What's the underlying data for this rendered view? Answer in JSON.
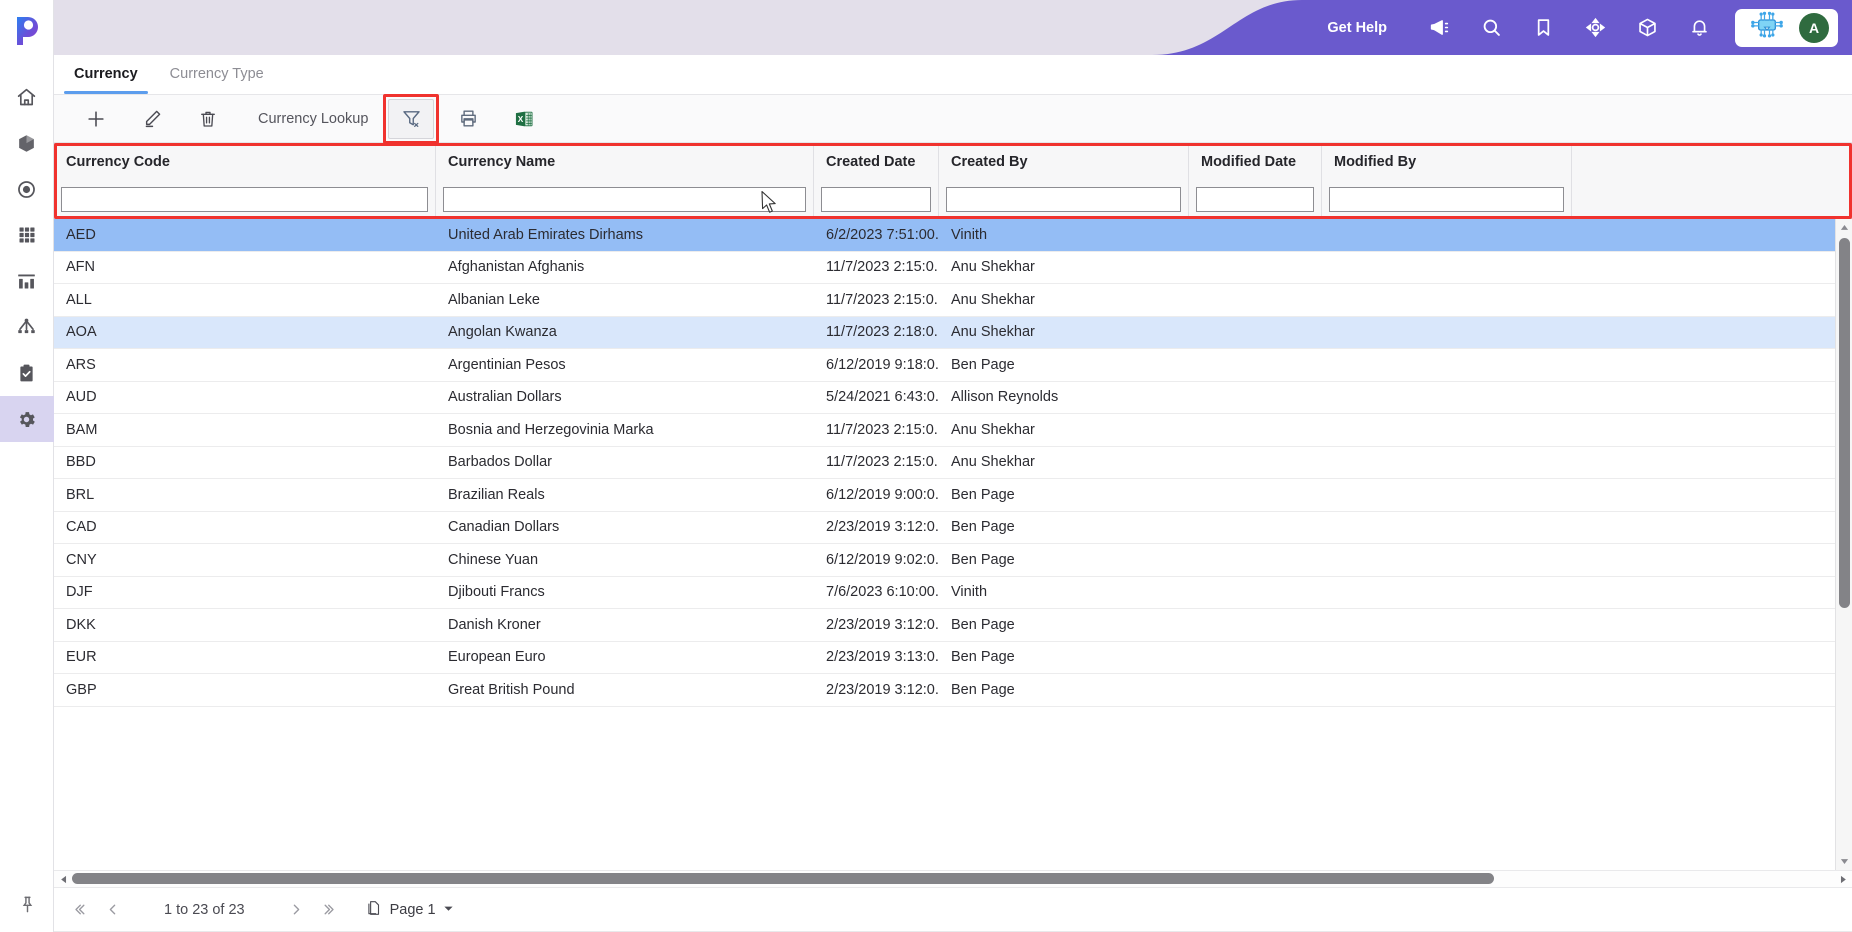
{
  "app": {
    "logo_icon": "priority-p-logo",
    "accent_purple": "#6a5acd",
    "header_bg": "#e3dfea",
    "tab_underline": "#5c9ded",
    "selected_row_color": "#94bdf5",
    "hover_row_color": "#d9e7fb",
    "highlight_ring_color": "#f0322e"
  },
  "rail": {
    "items": [
      {
        "icon": "home-icon",
        "name": "home",
        "active": false
      },
      {
        "icon": "cube-icon",
        "name": "products",
        "active": false
      },
      {
        "icon": "target-icon",
        "name": "target",
        "active": false
      },
      {
        "icon": "grid-icon",
        "name": "modules",
        "active": false
      },
      {
        "icon": "bar-chart-icon",
        "name": "reports",
        "active": false
      },
      {
        "icon": "hierarchy-icon",
        "name": "hierarchy",
        "active": false
      },
      {
        "icon": "clipboard-check-icon",
        "name": "tasks",
        "active": false
      },
      {
        "icon": "gear-icon",
        "name": "settings",
        "active": true
      }
    ],
    "pin_icon": "pin-icon"
  },
  "header": {
    "get_help_label": "Get Help",
    "icons": [
      {
        "icon": "megaphone-icon",
        "name": "announcements"
      },
      {
        "icon": "search-icon",
        "name": "search"
      },
      {
        "icon": "bookmark-icon",
        "name": "bookmarks"
      },
      {
        "icon": "crosshair-icon",
        "name": "navigator"
      },
      {
        "icon": "box-icon",
        "name": "packages"
      },
      {
        "icon": "bell-icon",
        "name": "notifications"
      }
    ],
    "ai_chip_icon": "ai-chip-icon",
    "avatar_initial": "A"
  },
  "tabs": [
    {
      "label": "Currency",
      "active": true
    },
    {
      "label": "Currency Type",
      "active": false
    }
  ],
  "toolbar": {
    "add_icon": "plus-icon",
    "edit_icon": "pencil-icon",
    "delete_icon": "trash-icon",
    "lookup_label": "Currency Lookup",
    "filter_icon": "filter-clear-icon",
    "print_icon": "printer-icon",
    "excel_icon": "excel-export-icon"
  },
  "grid": {
    "columns": [
      {
        "header": "Currency Code",
        "filter_value": ""
      },
      {
        "header": "Currency Name",
        "filter_value": ""
      },
      {
        "header": "Created Date",
        "filter_value": ""
      },
      {
        "header": "Created By",
        "filter_value": ""
      },
      {
        "header": "Modified Date",
        "filter_value": ""
      },
      {
        "header": "Modified By",
        "filter_value": ""
      }
    ],
    "rows": [
      {
        "code": "AED",
        "name": "United Arab Emirates Dirhams",
        "created_date": "6/2/2023 7:51:00...",
        "created_by": "Vinith",
        "modified_date": "",
        "modified_by": "",
        "state": "selected"
      },
      {
        "code": "AFN",
        "name": "Afghanistan Afghanis",
        "created_date": "11/7/2023 2:15:0...",
        "created_by": "Anu Shekhar",
        "modified_date": "",
        "modified_by": "",
        "state": ""
      },
      {
        "code": "ALL",
        "name": "Albanian Leke",
        "created_date": "11/7/2023 2:15:0...",
        "created_by": "Anu Shekhar",
        "modified_date": "",
        "modified_by": "",
        "state": ""
      },
      {
        "code": "AOA",
        "name": "Angolan Kwanza",
        "created_date": "11/7/2023 2:18:0...",
        "created_by": "Anu Shekhar",
        "modified_date": "",
        "modified_by": "",
        "state": "hover"
      },
      {
        "code": "ARS",
        "name": "Argentinian Pesos",
        "created_date": "6/12/2019 9:18:0...",
        "created_by": "Ben Page",
        "modified_date": "",
        "modified_by": "",
        "state": ""
      },
      {
        "code": "AUD",
        "name": "Australian Dollars",
        "created_date": "5/24/2021 6:43:0...",
        "created_by": "Allison Reynolds",
        "modified_date": "",
        "modified_by": "",
        "state": ""
      },
      {
        "code": "BAM",
        "name": "Bosnia and Herzegovinia Marka",
        "created_date": "11/7/2023 2:15:0...",
        "created_by": "Anu Shekhar",
        "modified_date": "",
        "modified_by": "",
        "state": ""
      },
      {
        "code": "BBD",
        "name": "Barbados Dollar",
        "created_date": "11/7/2023 2:15:0...",
        "created_by": "Anu Shekhar",
        "modified_date": "",
        "modified_by": "",
        "state": ""
      },
      {
        "code": "BRL",
        "name": "Brazilian Reals",
        "created_date": "6/12/2019 9:00:0...",
        "created_by": "Ben Page",
        "modified_date": "",
        "modified_by": "",
        "state": ""
      },
      {
        "code": "CAD",
        "name": "Canadian Dollars",
        "created_date": "2/23/2019 3:12:0...",
        "created_by": "Ben Page",
        "modified_date": "",
        "modified_by": "",
        "state": ""
      },
      {
        "code": "CNY",
        "name": "Chinese Yuan",
        "created_date": "6/12/2019 9:02:0...",
        "created_by": "Ben Page",
        "modified_date": "",
        "modified_by": "",
        "state": ""
      },
      {
        "code": "DJF",
        "name": "Djibouti Francs",
        "created_date": "7/6/2023 6:10:00...",
        "created_by": "Vinith",
        "modified_date": "",
        "modified_by": "",
        "state": ""
      },
      {
        "code": "DKK",
        "name": "Danish Kroner",
        "created_date": "2/23/2019 3:12:0...",
        "created_by": "Ben Page",
        "modified_date": "",
        "modified_by": "",
        "state": ""
      },
      {
        "code": "EUR",
        "name": "European Euro",
        "created_date": "2/23/2019 3:13:0...",
        "created_by": "Ben Page",
        "modified_date": "",
        "modified_by": "",
        "state": ""
      },
      {
        "code": "GBP",
        "name": "Great British Pound",
        "created_date": "2/23/2019 3:12:0...",
        "created_by": "Ben Page",
        "modified_date": "",
        "modified_by": "",
        "state": ""
      }
    ]
  },
  "pager": {
    "first_icon": "first-page-icon",
    "prev_icon": "prev-page-icon",
    "range_label": "1 to 23 of 23",
    "next_icon": "next-page-icon",
    "last_icon": "last-page-icon",
    "page_icon": "pages-icon",
    "page_label": "Page 1",
    "page_caret": "chevron-down-icon"
  }
}
